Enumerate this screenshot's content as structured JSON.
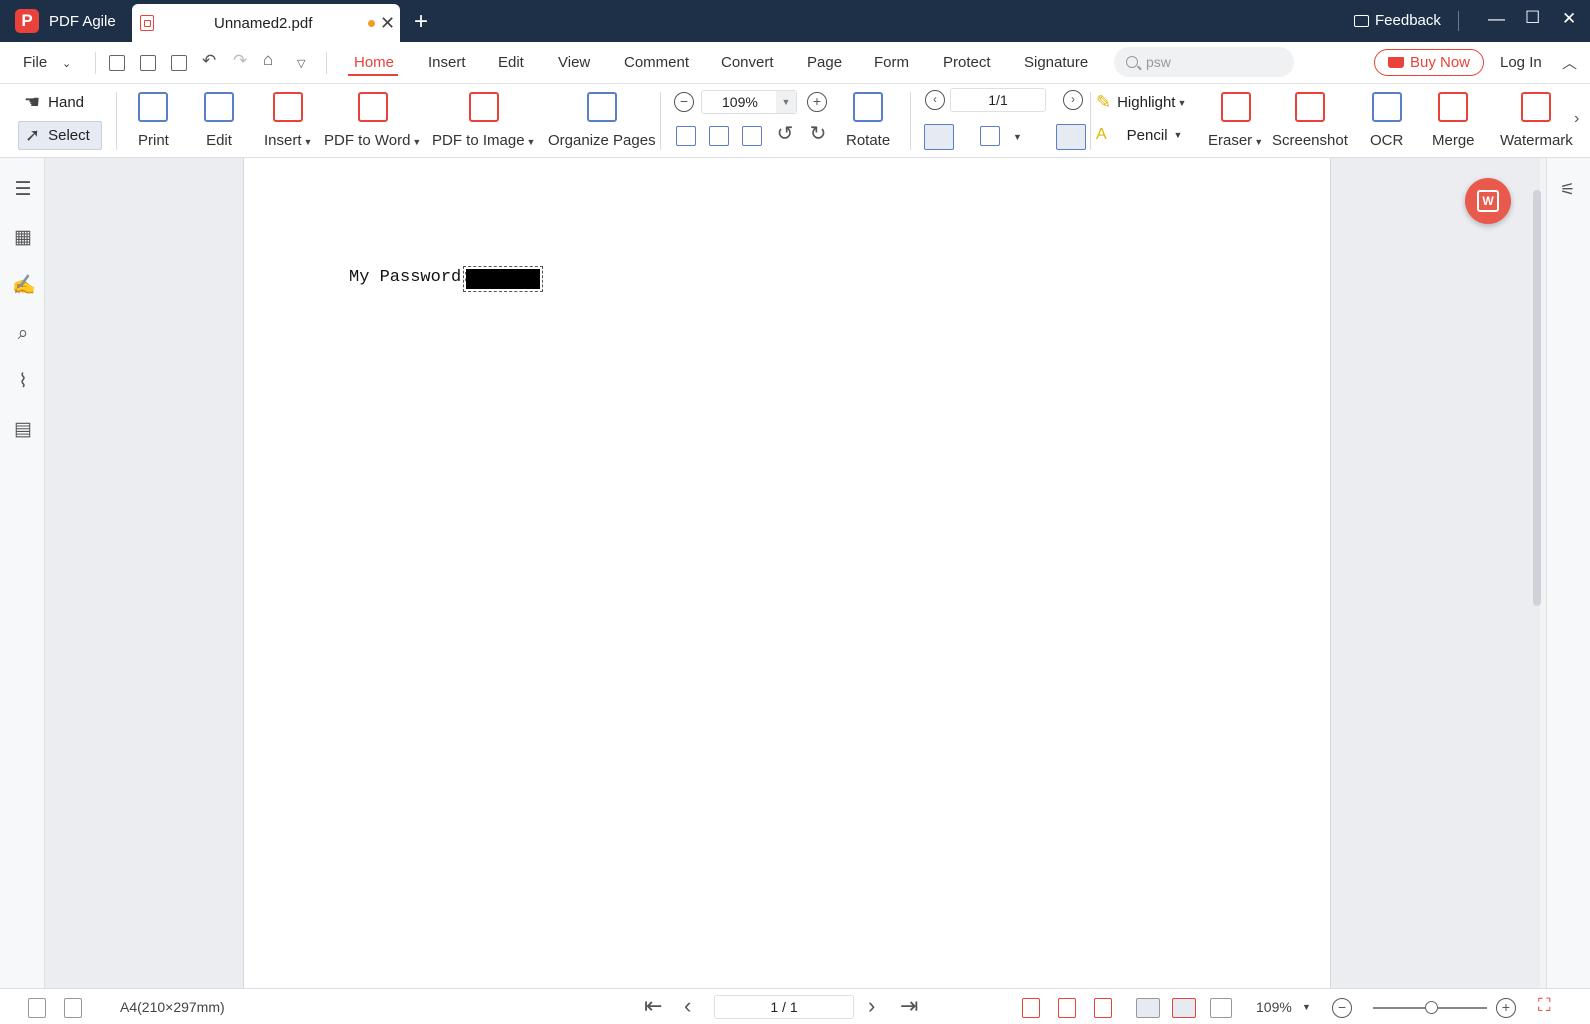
{
  "app": {
    "name": "PDF Agile",
    "logo_letter": "P",
    "brand_color": "#e8423b"
  },
  "tab": {
    "title": "Unnamed2.pdf",
    "unsaved": true
  },
  "titlebar": {
    "feedback": "Feedback"
  },
  "menu": {
    "file": "File",
    "items": [
      "Home",
      "Insert",
      "Edit",
      "View",
      "Comment",
      "Convert",
      "Page",
      "Form",
      "Protect",
      "Signature"
    ],
    "active": "Home",
    "search_value": "psw",
    "buy_now": "Buy Now",
    "login": "Log In"
  },
  "ribbon": {
    "hand": "Hand",
    "select": "Select",
    "print": "Print",
    "edit": "Edit",
    "insert": "Insert",
    "pdf_to_word": "PDF to Word",
    "pdf_to_image": "PDF to Image",
    "organize_pages": "Organize Pages",
    "zoom": "109%",
    "page": "1/1",
    "rotate": "Rotate",
    "highlight": "Highlight",
    "pencil": "Pencil",
    "eraser": "Eraser",
    "screenshot": "Screenshot",
    "ocr": "OCR",
    "merge": "Merge",
    "watermark": "Watermark"
  },
  "document": {
    "text": "My Password:"
  },
  "statusbar": {
    "page_size": "A4(210×297mm)",
    "page": "1 / 1",
    "zoom": "109%"
  }
}
